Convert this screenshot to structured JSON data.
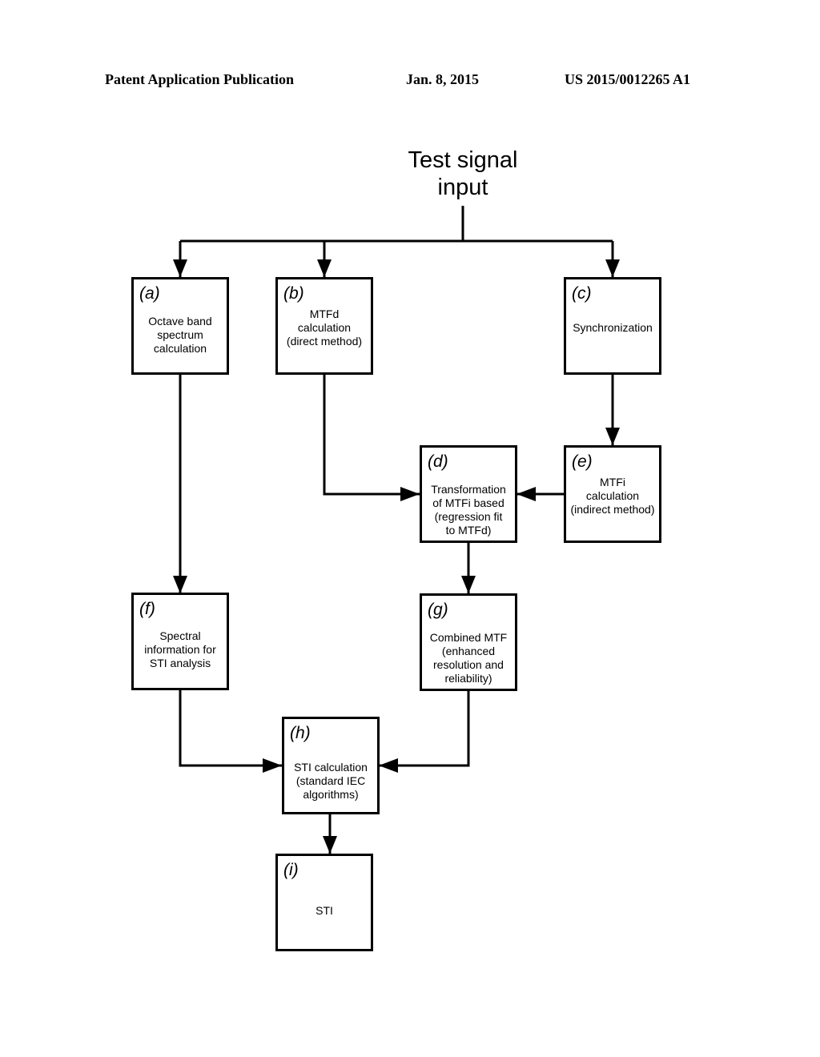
{
  "header": {
    "left": "Patent Application Publication",
    "date": "Jan. 8, 2015",
    "number": "US 2015/0012265 A1"
  },
  "diagram": {
    "title": "Test signal\ninput",
    "nodes": {
      "a": {
        "label": "(a)",
        "text": "Octave band\nspectrum\ncalculation"
      },
      "b": {
        "label": "(b)",
        "text": "MTFd\ncalculation\n(direct method)"
      },
      "c": {
        "label": "(c)",
        "text": "Synchronization"
      },
      "d": {
        "label": "(d)",
        "text": "Transformation\nof MTFi based\n(regression fit\nto MTFd)"
      },
      "e": {
        "label": "(e)",
        "text": "MTFi\ncalculation\n(indirect method)"
      },
      "f": {
        "label": "(f)",
        "text": "Spectral\ninformation for\nSTI analysis"
      },
      "g": {
        "label": "(g)",
        "text": "Combined MTF\n(enhanced\nresolution and\nreliability)"
      },
      "h": {
        "label": "(h)",
        "text": "STI calculation\n(standard IEC\nalgorithms)"
      },
      "i": {
        "label": "(i)",
        "text": "STI"
      }
    },
    "edges": [
      [
        "input",
        "a"
      ],
      [
        "input",
        "b"
      ],
      [
        "input",
        "c"
      ],
      [
        "c",
        "e"
      ],
      [
        "b",
        "d"
      ],
      [
        "e",
        "d"
      ],
      [
        "a",
        "f"
      ],
      [
        "d",
        "g"
      ],
      [
        "f",
        "h"
      ],
      [
        "g",
        "h"
      ],
      [
        "h",
        "i"
      ]
    ]
  }
}
